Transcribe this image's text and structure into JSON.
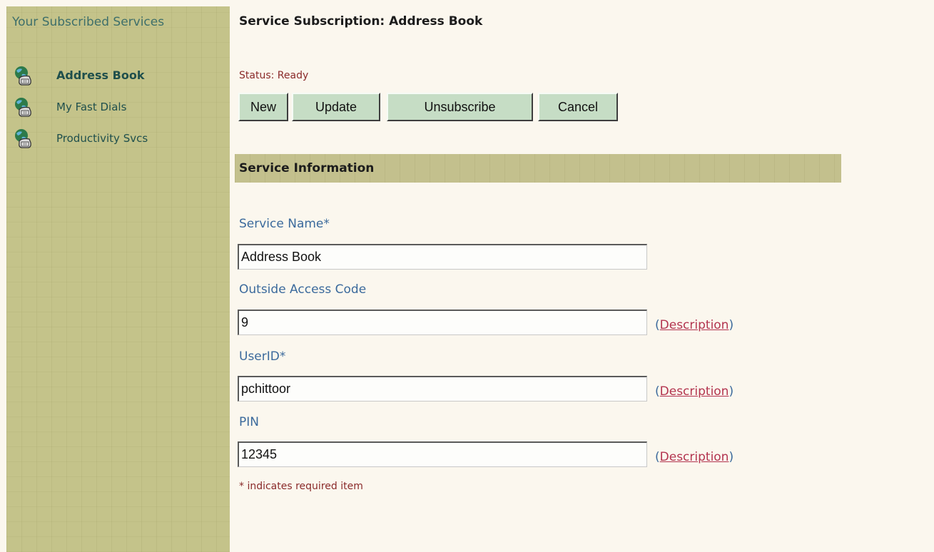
{
  "sidebar": {
    "title": "Your Subscribed Services",
    "items": [
      {
        "label": "Address Book",
        "icon": "globe-phone-icon",
        "active": true
      },
      {
        "label": "My Fast Dials",
        "icon": "globe-phone-icon",
        "active": false
      },
      {
        "label": "Productivity Svcs",
        "icon": "globe-phone-icon",
        "active": false
      }
    ]
  },
  "page": {
    "title": "Service Subscription: Address Book"
  },
  "status": {
    "text": "Status: Ready"
  },
  "buttons": {
    "new": "New",
    "update": "Update",
    "unsubscribe": "Unsubscribe",
    "cancel": "Cancel"
  },
  "section": {
    "title": "Service Information"
  },
  "fields": {
    "service_name": {
      "label": "Service Name*",
      "value": "Address Book"
    },
    "outside_access_code": {
      "label": "Outside Access Code",
      "value": "9"
    },
    "userid": {
      "label": "UserID*",
      "value": "pchittoor"
    },
    "pin": {
      "label": "PIN",
      "value": "12345"
    }
  },
  "description_link": {
    "open": "(",
    "text": "Description",
    "close": ")"
  },
  "required_note": "* indicates required item",
  "colors": {
    "sidebar_bg": "#c4c38a",
    "page_bg": "#fbf7ee",
    "button_bg": "#c6ddc5",
    "label_blue": "#3b6a9c",
    "status_red": "#8a2a2a",
    "link_red": "#b3344f"
  }
}
